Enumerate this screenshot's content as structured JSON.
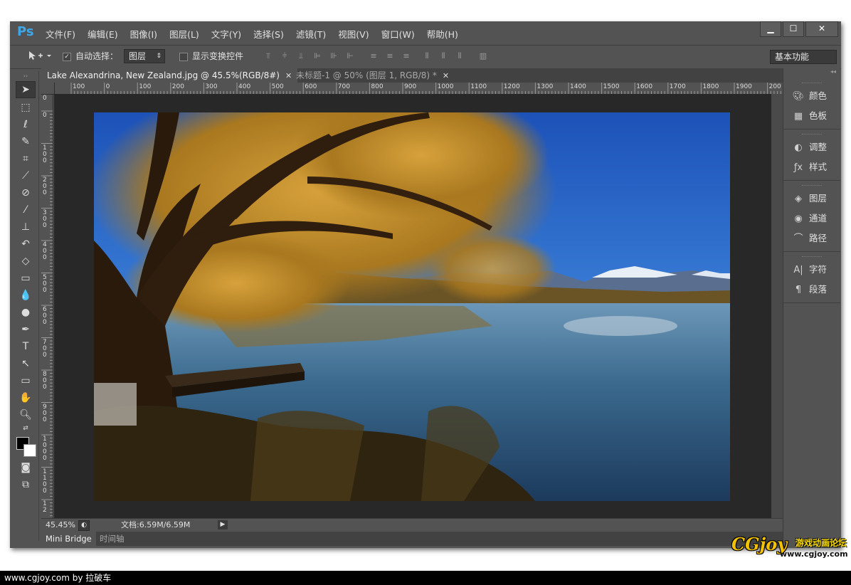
{
  "app": {
    "logo": "Ps"
  },
  "menu": [
    "文件(F)",
    "编辑(E)",
    "图像(I)",
    "图层(L)",
    "文字(Y)",
    "选择(S)",
    "滤镜(T)",
    "视图(V)",
    "窗口(W)",
    "帮助(H)"
  ],
  "window_buttons": {
    "minimize": "▁",
    "maximize": "☐",
    "close": "✕"
  },
  "options": {
    "tool_icon": "move-tool-icon",
    "auto_select_label": "自动选择：",
    "auto_select_checked": true,
    "auto_select_value": "图层",
    "show_transform_label": "显示变换控件",
    "show_transform_checked": false,
    "workspace": "基本功能"
  },
  "tabs": [
    {
      "label": "Lake Alexandrina, New Zealand.jpg @ 45.5%(RGB/8#)",
      "active": true
    },
    {
      "label": "未标题-1 @ 50% (图层 1, RGB/8) *",
      "active": false
    }
  ],
  "ruler_h": [
    "100",
    "0",
    "100",
    "200",
    "300",
    "400",
    "500",
    "600",
    "700",
    "800",
    "900",
    "1000",
    "1100",
    "1200",
    "1300",
    "1400",
    "1500",
    "1600",
    "1700",
    "1800",
    "1900",
    "200"
  ],
  "ruler_v": [
    "0",
    "0",
    "100",
    "200",
    "300",
    "400",
    "500",
    "600",
    "700",
    "800",
    "900",
    "1000",
    "1100",
    "12"
  ],
  "status": {
    "zoom": "45.45%",
    "doc": "文档:6.59M/6.59M"
  },
  "bottom_tabs": [
    "Mini Bridge",
    "时间轴"
  ],
  "panels": [
    [
      {
        "label": "颜色",
        "icon": "palette-icon"
      },
      {
        "label": "色板",
        "icon": "swatches-icon"
      }
    ],
    [
      {
        "label": "调整",
        "icon": "adjustments-icon"
      },
      {
        "label": "样式",
        "icon": "styles-icon"
      }
    ],
    [
      {
        "label": "图层",
        "icon": "layers-icon"
      },
      {
        "label": "通道",
        "icon": "channels-icon"
      },
      {
        "label": "路径",
        "icon": "paths-icon"
      }
    ],
    [
      {
        "label": "字符",
        "icon": "character-icon"
      },
      {
        "label": "段落",
        "icon": "paragraph-icon"
      }
    ]
  ],
  "footer": "www.cgjoy.com by 拉破车",
  "watermark": {
    "logo": "CGjoy",
    "tagline": "游戏动画论坛",
    "url": "www.cgjoy.com"
  }
}
